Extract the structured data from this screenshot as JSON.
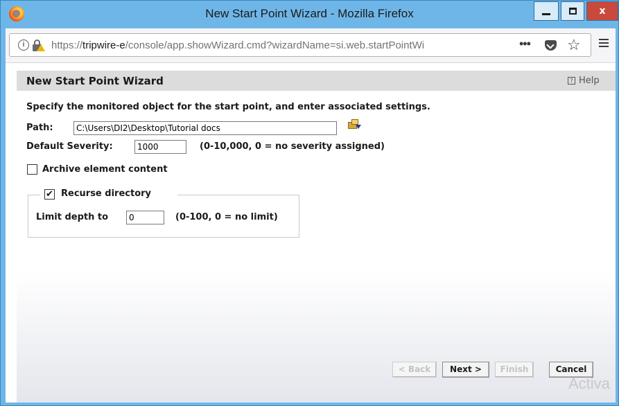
{
  "window": {
    "title": "New Start Point Wizard - Mozilla Firefox",
    "close_glyph": "x"
  },
  "browser": {
    "url_prefix": "https://",
    "url_host": "tripwire-e",
    "url_path": "/console/app.showWizard.cmd?wizardName=si.web.startPointWi",
    "page_actions_glyph": "•••",
    "bookmark_glyph": "☆"
  },
  "wizard": {
    "title": "New Start Point Wizard",
    "help_label": "Help",
    "instruction": "Specify the monitored object for the start point, and enter associated settings.",
    "path": {
      "label": "Path:",
      "value": "C:\\Users\\DI2\\Desktop\\Tutorial docs"
    },
    "severity": {
      "label": "Default Severity:",
      "value": "1000",
      "hint": "(0-10,000, 0 = no severity assigned)"
    },
    "archive": {
      "label": "Archive element content",
      "checked": false
    },
    "recurse": {
      "label": "Recurse directory",
      "checked": true,
      "check_glyph": "✔"
    },
    "depth": {
      "label": "Limit depth to",
      "value": "0",
      "hint": "(0-100, 0 = no limit)"
    },
    "buttons": {
      "back": "< Back",
      "next": "Next >",
      "finish": "Finish",
      "cancel": "Cancel"
    }
  },
  "watermark": "Activa"
}
